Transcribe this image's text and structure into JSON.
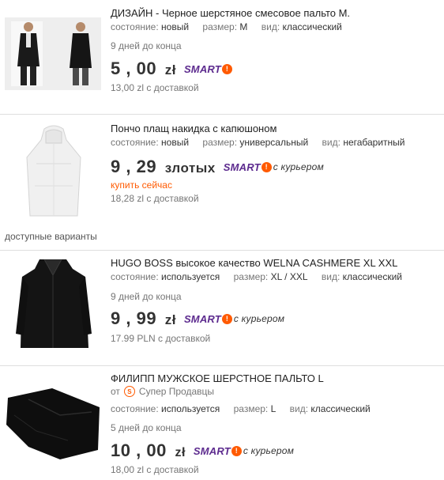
{
  "labels": {
    "condition": "состояние:",
    "size": "размер:",
    "type": "вид:",
    "buy_now": "купить сейчас",
    "variants": "доступные варианты",
    "smart": "SMART",
    "smart_mark": "!",
    "courier": "с курьером",
    "seller_prefix": "от"
  },
  "listings": [
    {
      "title": "ДИЗАЙН - Черное шерстяное смесовое пальто M.",
      "condition": "новый",
      "size": "M",
      "type": "классический",
      "time_left": "9 дней до конца",
      "price_int": "5",
      "price_frac": ", 00",
      "currency": "zł",
      "shipping": "13,00 zl с доставкой"
    },
    {
      "title": "Пончо плащ накидка с капюшоном",
      "condition": "новый",
      "size": "универсальный",
      "type": "негабаритный",
      "price_int": "9",
      "price_frac": ", 29",
      "currency": "злотых",
      "shipping": "18,28 zl с доставкой"
    },
    {
      "title": "HUGO BOSS высокое качество WELNA CASHMERE XL XXL",
      "condition": "используется",
      "size": "XL / XXL",
      "type": "классический",
      "time_left": "9 дней до конца",
      "price_int": "9",
      "price_frac": ", 99",
      "currency": "zł",
      "shipping": "17.99 PLN с доставкой"
    },
    {
      "title": "ФИЛИПП МУЖСКОЕ ШЕРСТНОЕ ПАЛЬТО L",
      "seller_name": "Супер Продавцы",
      "condition": "используется",
      "size": "L",
      "type": "классический",
      "time_left": "5 дней до конца",
      "price_int": "10",
      "price_frac": ", 00",
      "currency": "zł",
      "shipping": "18,00 zl с доставкой"
    }
  ]
}
